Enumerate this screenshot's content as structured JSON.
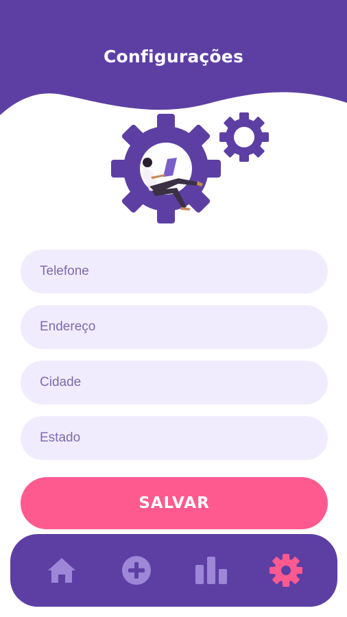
{
  "colors": {
    "header": "#5d3fa4",
    "accent_pink": "#fe5a8f",
    "field_bg": "#f1ecfd",
    "nav_inactive": "#9d87d6"
  },
  "header": {
    "title": "Configurações"
  },
  "form": {
    "fields": [
      {
        "placeholder": "Telefone",
        "value": ""
      },
      {
        "placeholder": "Endereço",
        "value": ""
      },
      {
        "placeholder": "Cidade",
        "value": ""
      },
      {
        "placeholder": "Estado",
        "value": ""
      }
    ],
    "save_label": "SALVAR"
  },
  "bottom_nav": {
    "items": [
      {
        "icon": "home-icon",
        "active": false
      },
      {
        "icon": "add-circle-icon",
        "active": false
      },
      {
        "icon": "bar-chart-icon",
        "active": false
      },
      {
        "icon": "gear-icon",
        "active": true
      }
    ]
  }
}
